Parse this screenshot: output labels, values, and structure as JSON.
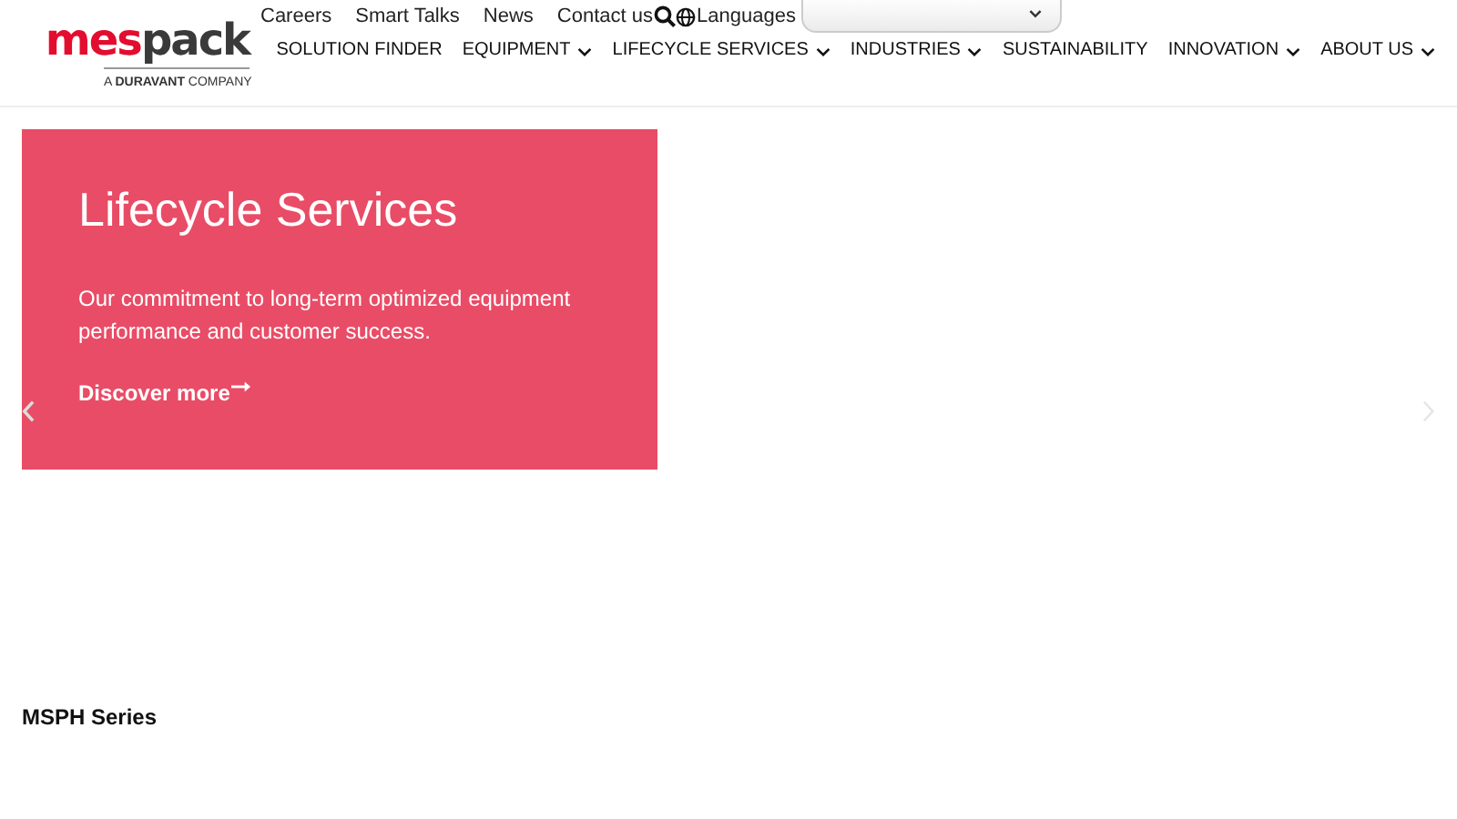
{
  "logo": {
    "text_1": "mes",
    "text_2": "pack",
    "tagline": "A **DURAVANT** COMPANY"
  },
  "top_links": [
    "Careers",
    "Smart Talks",
    "News",
    "Contact us"
  ],
  "languages_label": "Languages",
  "nav": [
    {
      "label": "SOLUTION FINDER",
      "dropdown": false
    },
    {
      "label": "EQUIPMENT",
      "dropdown": true
    },
    {
      "label": "LIFECYCLE SERVICES",
      "dropdown": true
    },
    {
      "label": "INDUSTRIES",
      "dropdown": true
    },
    {
      "label": "SUSTAINABILITY",
      "dropdown": false
    },
    {
      "label": "INNOVATION",
      "dropdown": true
    },
    {
      "label": "ABOUT US",
      "dropdown": true
    }
  ],
  "hero": {
    "title": "Lifecycle Services",
    "text": "Our commitment to long-term optimized equipment performance and customer success.",
    "link": "Discover more"
  },
  "section_title": "MSPH Series"
}
